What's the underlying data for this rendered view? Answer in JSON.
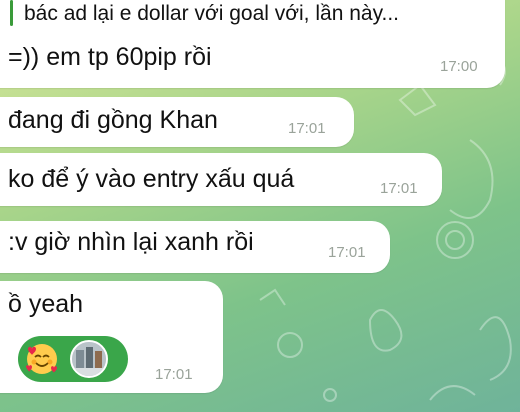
{
  "messages": [
    {
      "quote": "bác ad lại e dollar với goal với, lần này...",
      "text": "=)) em tp 60pip rồi",
      "time": "17:00"
    },
    {
      "text": "đang đi gồng Khan",
      "time": "17:01"
    },
    {
      "text": "ko để ý vào entry xấu quá",
      "time": "17:01"
    },
    {
      "text": ":v giờ nhìn lại xanh rồi",
      "time": "17:01"
    },
    {
      "text": "ồ yeah",
      "time": "17:01",
      "reaction": {
        "emoji_icon": "smiling-face-with-hearts-icon",
        "reactor": "user-avatar"
      }
    }
  ],
  "colors": {
    "bubble": "#ffffff",
    "quote_bar": "#3a9b3a",
    "reaction_pill": "#3aa64a",
    "time_text": "#9aa39a"
  }
}
